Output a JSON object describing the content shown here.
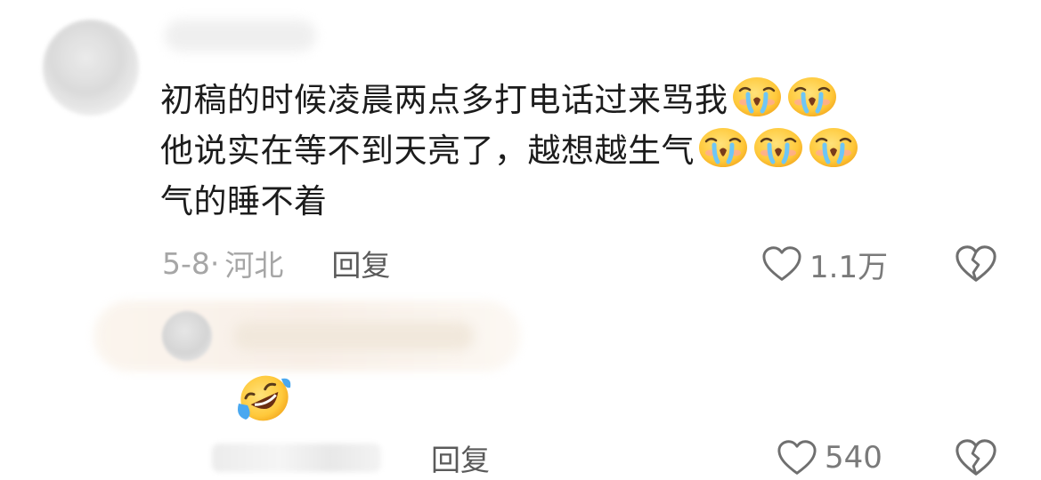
{
  "comment": {
    "lines": [
      {
        "text": "初稿的时候凌晨两点多打电话过来骂我",
        "emojis": [
          "crying-face-emoji",
          "crying-face-emoji"
        ]
      },
      {
        "text": "他说实在等不到天亮了，越想越生气",
        "emojis": [
          "crying-face-emoji",
          "crying-face-emoji",
          "crying-face-emoji"
        ]
      },
      {
        "text": "气的睡不着",
        "emojis": []
      }
    ],
    "date": "5-8·",
    "location": "河北",
    "reply_label": "回复",
    "like_count": "1.1万"
  },
  "reply": {
    "emoji": "rolling-laughing-emoji",
    "reply_label": "回复",
    "like_count": "540"
  },
  "colors": {
    "text": "#1c1c1c",
    "meta": "#a6a6a6",
    "reply": "#5a5a5a",
    "icon": "#6f6f6f",
    "emoji_yellow": "#ffc93b"
  }
}
